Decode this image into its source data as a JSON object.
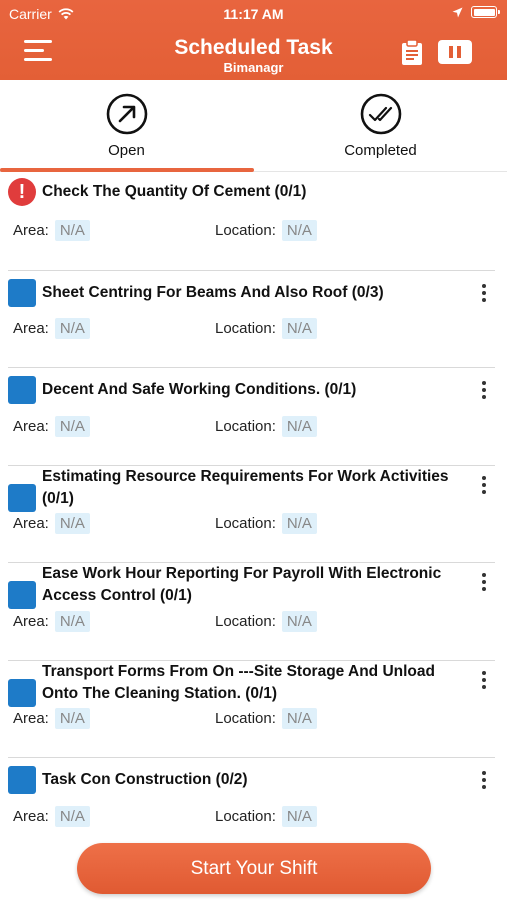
{
  "status_bar": {
    "carrier": "Carrier",
    "time": "11:17 AM"
  },
  "header": {
    "title": "Scheduled Task",
    "subtitle": "Bimanagr"
  },
  "tabs": [
    {
      "label": "Open",
      "icon": "arrow-up-right-circle-icon",
      "active": true
    },
    {
      "label": "Completed",
      "icon": "double-check-circle-icon",
      "active": false
    }
  ],
  "meta_labels": {
    "area": "Area:",
    "location": "Location:"
  },
  "tasks": [
    {
      "title": "Check The Quantity Of Cement (0/1)",
      "marker": "alert",
      "area": "N/A",
      "location": "N/A"
    },
    {
      "title": "Sheet Centring For Beams And Also Roof (0/3)",
      "marker": "square",
      "area": "N/A",
      "location": "N/A"
    },
    {
      "title": "Decent And Safe Working Conditions. (0/1)",
      "marker": "square",
      "area": "N/A",
      "location": "N/A"
    },
    {
      "title": "Estimating Resource Requirements For Work Activities (0/1)",
      "marker": "square",
      "area": "N/A",
      "location": "N/A"
    },
    {
      "title": "Ease Work Hour Reporting For Payroll With Electronic Access Control (0/1)",
      "marker": "square",
      "area": "N/A",
      "location": "N/A"
    },
    {
      "title": "Transport Forms From On ---Site Storage And Unload Onto The Cleaning Station. (0/1)",
      "marker": "square",
      "area": "N/A",
      "location": "N/A"
    },
    {
      "title": "Task Con Construction (0/2)",
      "marker": "square",
      "area": "N/A",
      "location": "N/A"
    }
  ],
  "cta": {
    "label": "Start Your Shift"
  },
  "colors": {
    "brand": "#e35f36",
    "task_marker": "#1e7bc8",
    "alert": "#e03c3c",
    "chip_bg": "#dff0fa"
  }
}
